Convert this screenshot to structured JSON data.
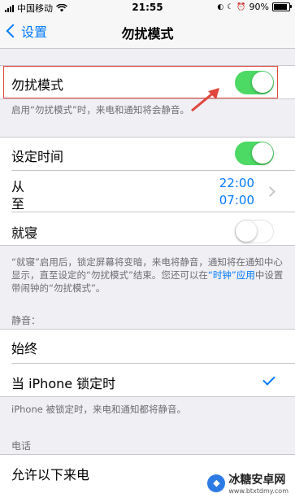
{
  "status_bar": {
    "carrier": "中国移动",
    "time": "21:55",
    "battery": "90%",
    "battery_level": 0.9
  },
  "nav": {
    "back_label": "设置",
    "title": "勿扰模式"
  },
  "dnd": {
    "label": "勿扰模式",
    "enabled": true,
    "footer": "启用“勿扰模式”时，来电和通知将会静音。"
  },
  "schedule": {
    "label": "设定时间",
    "enabled": true,
    "from_label": "从",
    "to_label": "至",
    "from_time": "22:00",
    "to_time": "07:00"
  },
  "bedtime": {
    "label": "就寝",
    "enabled": false,
    "footer_part1": "“就寝”启用后，锁定屏幕将变暗，来电将静音，通知将在通知中心显示，直至设定的“勿扰模式”结束。您还可以在",
    "footer_link": "“时钟”应用",
    "footer_part2": "中设置带闹钟的“勿扰模式”。"
  },
  "silence": {
    "header": "静音：",
    "always_label": "始终",
    "locked_label": "当 iPhone 锁定时",
    "footer": "iPhone 被锁定时，来电和通知都将静音。"
  },
  "phone": {
    "header": "电话",
    "allow_calls_label": "允许以下来电"
  },
  "colors": {
    "accent": "#007aff",
    "toggle_on": "#4cd964",
    "highlight": "#e0463c"
  },
  "watermark": {
    "title": "冰糖安卓网",
    "url": "www.btxtdmy.com"
  }
}
